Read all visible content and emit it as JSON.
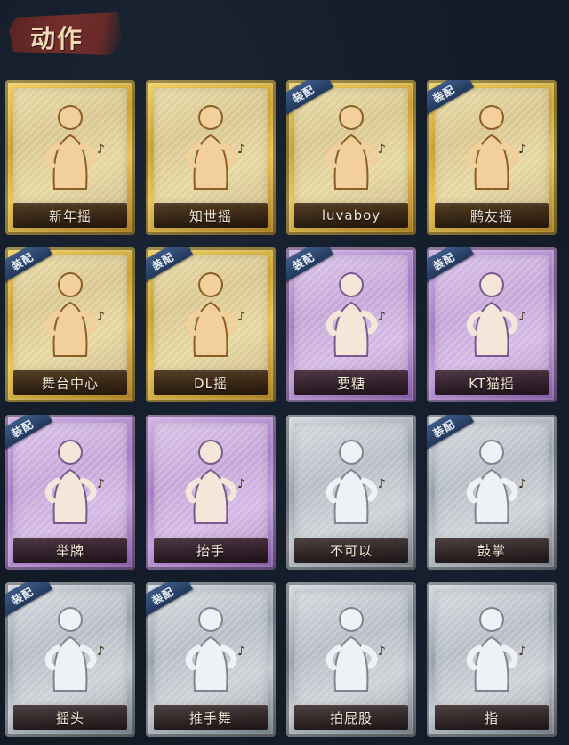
{
  "header": {
    "title": "动作"
  },
  "equipped_label": "装配",
  "cards": [
    {
      "name": "新年摇",
      "rarity": "gold",
      "equipped": false,
      "icon": "figure-swaying-notes-icon"
    },
    {
      "name": "知世摇",
      "rarity": "gold",
      "equipped": false,
      "icon": "figure-dancing-notes-icon"
    },
    {
      "name": "luvaboy",
      "rarity": "gold",
      "equipped": true,
      "icon": "figure-arms-crossed-icon"
    },
    {
      "name": "鹏友摇",
      "rarity": "gold",
      "equipped": true,
      "icon": "figure-pointing-icon"
    },
    {
      "name": "舞台中心",
      "rarity": "gold",
      "equipped": true,
      "icon": "figure-center-stage-icon"
    },
    {
      "name": "DL摇",
      "rarity": "gold",
      "equipped": true,
      "icon": "figure-arm-raised-icon"
    },
    {
      "name": "要糖",
      "rarity": "purple",
      "equipped": true,
      "icon": "figure-asking-candy-icon"
    },
    {
      "name": "KT猫摇",
      "rarity": "purple",
      "equipped": true,
      "icon": "figure-cat-sway-icon"
    },
    {
      "name": "举牌",
      "rarity": "purple",
      "equipped": true,
      "icon": "figure-holding-sign-icon"
    },
    {
      "name": "抬手",
      "rarity": "purple",
      "equipped": false,
      "icon": "figure-raising-hand-icon"
    },
    {
      "name": "不可以",
      "rarity": "silver",
      "equipped": false,
      "icon": "finger-wagging-icon"
    },
    {
      "name": "鼓掌",
      "rarity": "silver",
      "equipped": true,
      "icon": "clapping-hands-icon"
    },
    {
      "name": "摇头",
      "rarity": "silver",
      "equipped": true,
      "icon": "figure-head-shake-icon"
    },
    {
      "name": "推手舞",
      "rarity": "silver",
      "equipped": true,
      "icon": "figure-push-dance-icon"
    },
    {
      "name": "拍屁股",
      "rarity": "silver",
      "equipped": false,
      "icon": "figure-bottom-pat-icon"
    },
    {
      "name": "指",
      "rarity": "silver",
      "equipped": false,
      "icon": "pointing-hand-icon"
    }
  ],
  "colors": {
    "gold": "#d9b443",
    "purple": "#b08ad0",
    "silver": "#b5bcc4",
    "badge": "#2e4a72",
    "background": "#121a26",
    "header_brush": "#6e2b29"
  }
}
